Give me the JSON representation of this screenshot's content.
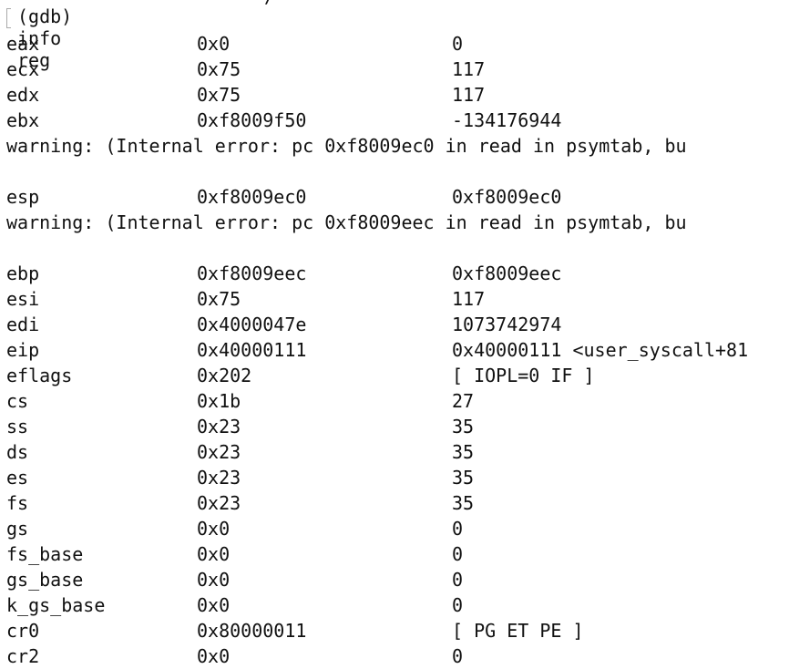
{
  "prompt": "(gdb) info reg",
  "top_fragment": "/",
  "lines": [
    {
      "type": "reg",
      "name": "eax",
      "hex": "0x0",
      "value": "0"
    },
    {
      "type": "reg",
      "name": "ecx",
      "hex": "0x75",
      "value": "117"
    },
    {
      "type": "reg",
      "name": "edx",
      "hex": "0x75",
      "value": "117"
    },
    {
      "type": "reg",
      "name": "ebx",
      "hex": "0xf8009f50",
      "value": "-134176944"
    },
    {
      "type": "warning",
      "text": "warning: (Internal error: pc 0xf8009ec0 in read in psymtab, bu"
    },
    {
      "type": "blank"
    },
    {
      "type": "reg",
      "name": "esp",
      "hex": "0xf8009ec0",
      "value": "0xf8009ec0"
    },
    {
      "type": "warning",
      "text": "warning: (Internal error: pc 0xf8009eec in read in psymtab, bu"
    },
    {
      "type": "blank"
    },
    {
      "type": "reg",
      "name": "ebp",
      "hex": "0xf8009eec",
      "value": "0xf8009eec"
    },
    {
      "type": "reg",
      "name": "esi",
      "hex": "0x75",
      "value": "117"
    },
    {
      "type": "reg",
      "name": "edi",
      "hex": "0x4000047e",
      "value": "1073742974"
    },
    {
      "type": "reg",
      "name": "eip",
      "hex": "0x40000111",
      "value": "0x40000111 <user_syscall+81"
    },
    {
      "type": "reg",
      "name": "eflags",
      "hex": "0x202",
      "value": "[ IOPL=0 IF ]"
    },
    {
      "type": "reg",
      "name": "cs",
      "hex": "0x1b",
      "value": "27"
    },
    {
      "type": "reg",
      "name": "ss",
      "hex": "0x23",
      "value": "35"
    },
    {
      "type": "reg",
      "name": "ds",
      "hex": "0x23",
      "value": "35"
    },
    {
      "type": "reg",
      "name": "es",
      "hex": "0x23",
      "value": "35"
    },
    {
      "type": "reg",
      "name": "fs",
      "hex": "0x23",
      "value": "35"
    },
    {
      "type": "reg",
      "name": "gs",
      "hex": "0x0",
      "value": "0"
    },
    {
      "type": "reg",
      "name": "fs_base",
      "hex": "0x0",
      "value": "0"
    },
    {
      "type": "reg",
      "name": "gs_base",
      "hex": "0x0",
      "value": "0"
    },
    {
      "type": "reg",
      "name": "k_gs_base",
      "hex": "0x0",
      "value": "0"
    },
    {
      "type": "reg",
      "name": "cr0",
      "hex": "0x80000011",
      "value": "[ PG ET PE ]"
    },
    {
      "type": "reg",
      "name": "cr2",
      "hex": "0x0",
      "value": "0"
    }
  ]
}
